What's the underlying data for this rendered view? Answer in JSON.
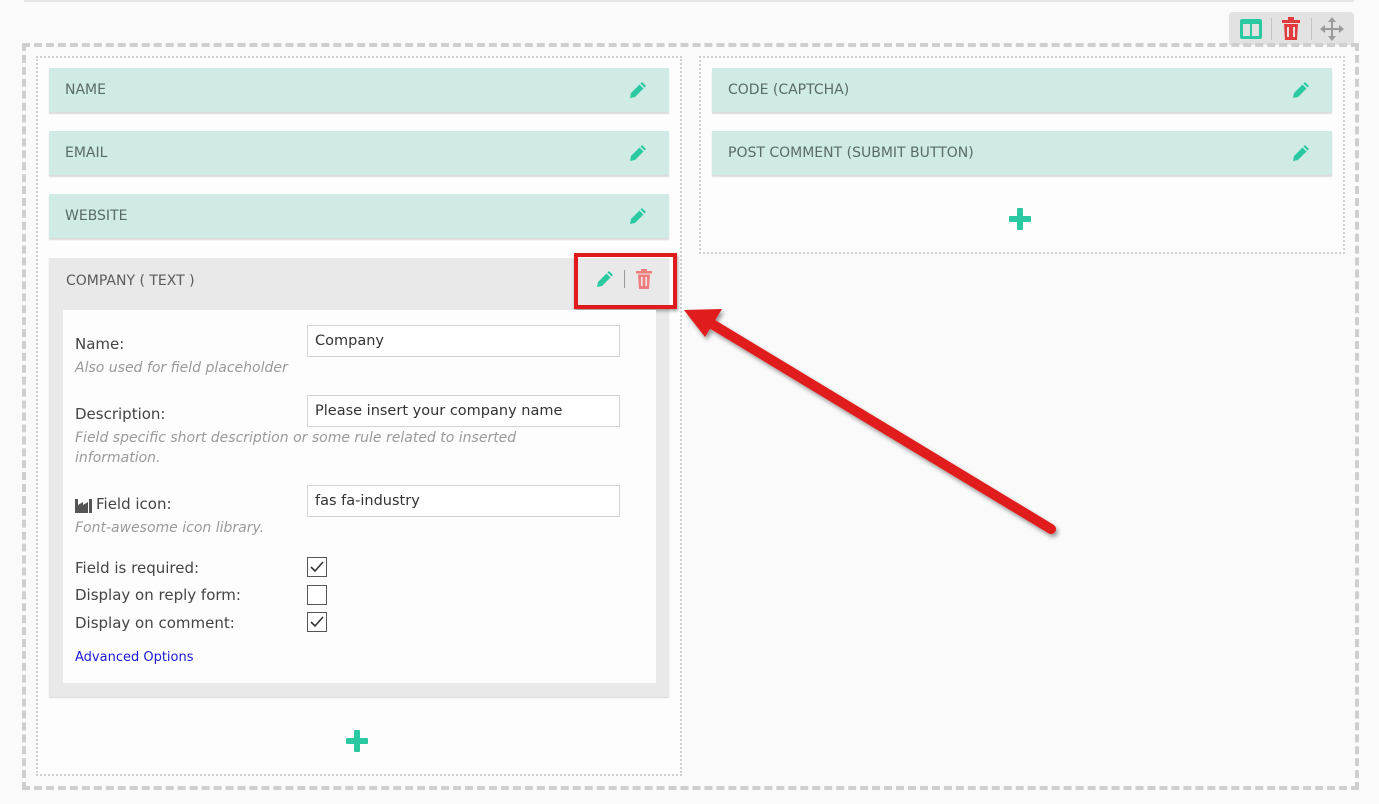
{
  "toolbar": {
    "icons": [
      "columns-icon",
      "trash-icon",
      "move-icon"
    ]
  },
  "left_column": {
    "fields": [
      {
        "label": "NAME"
      },
      {
        "label": "EMAIL"
      },
      {
        "label": "WEBSITE"
      }
    ],
    "company": {
      "header": "COMPANY ( TEXT )",
      "name_label": "Name:",
      "name_hint": "Also used for field placeholder",
      "name_value": "Company",
      "description_label": "Description:",
      "description_hint": "Field specific short description or some rule related to inserted information.",
      "description_value": "Please insert your company name",
      "icon_label": "Field icon:",
      "icon_hint": "Font-awesome icon library.",
      "icon_value": "fas fa-industry",
      "required_label": "Field is required:",
      "required_checked": true,
      "reply_label": "Display on reply form:",
      "reply_checked": false,
      "comment_label": "Display on comment:",
      "comment_checked": true,
      "advanced_label": "Advanced Options"
    }
  },
  "right_column": {
    "fields": [
      {
        "label": "CODE (CAPTCHA)"
      },
      {
        "label": "POST COMMENT (SUBMIT BUTTON)"
      }
    ]
  },
  "colors": {
    "accent": "#2bc9a1",
    "field_bg": "#d0ebe5",
    "delete": "#e85757",
    "highlight": "#e11b1b"
  }
}
